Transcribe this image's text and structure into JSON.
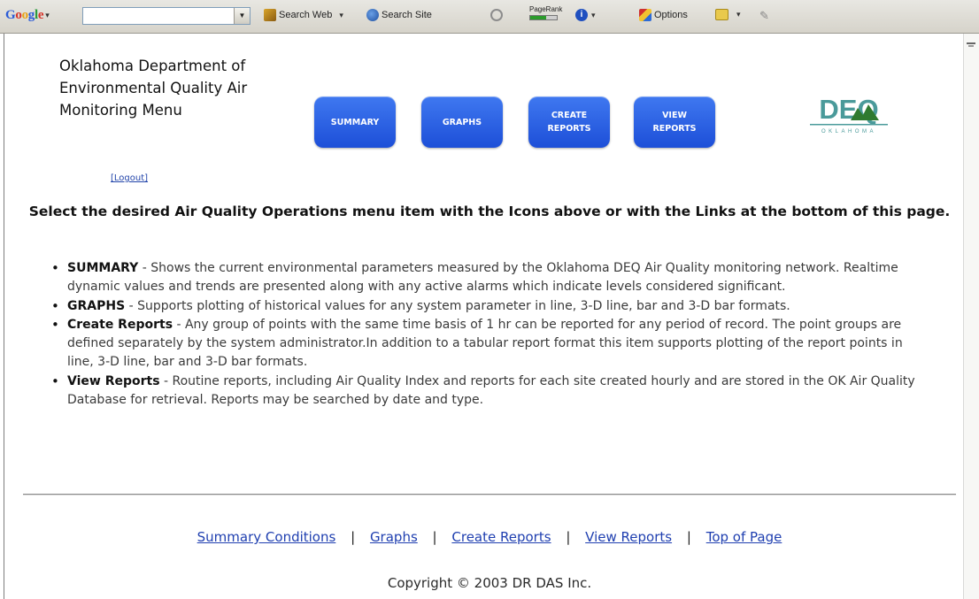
{
  "toolbar": {
    "logo_letters": [
      "G",
      "o",
      "o",
      "g",
      "l",
      "e"
    ],
    "search_value": "",
    "search_web": "Search Web",
    "search_site": "Search Site",
    "pagerank": "PageRank",
    "options": "Options"
  },
  "header": {
    "title": "Oklahoma Department of Environmental Quality Air Monitoring Menu",
    "logout": "[Logout]"
  },
  "nav": {
    "summary": "SUMMARY",
    "graphs": "GRAPHS",
    "create_reports": "CREATE REPORTS",
    "view_reports": "VIEW REPORTS"
  },
  "logo": {
    "text": "DEQ",
    "sub": "OKLAHOMA"
  },
  "instructions": "Select the desired Air Quality Operations menu item with the Icons above or with the Links at the bottom of this page.",
  "features": [
    {
      "term": "SUMMARY",
      "desc": " - Shows the current environmental parameters measured by the Oklahoma DEQ Air Quality monitoring network. Realtime dynamic values and trends are presented along with any active alarms which indicate levels considered significant."
    },
    {
      "term": "GRAPHS",
      "desc": " - Supports plotting of historical values for any system parameter in line, 3-D line, bar and 3-D bar formats."
    },
    {
      "term": "Create Reports",
      "desc": " - Any group of points with the same time basis of 1 hr can be reported for any period of record. The point groups are defined separately by the system administrator.In addition to a tabular report format this item supports plotting of the report points in line, 3-D line, bar and 3-D bar formats."
    },
    {
      "term": "View Reports",
      "desc": " - Routine reports, including Air Quality Index and reports for each site created hourly and are stored in the OK Air Quality Database for retrieval. Reports may be searched by date and type."
    }
  ],
  "footer": {
    "links": [
      "Summary Conditions",
      "Graphs",
      "Create Reports",
      "View Reports",
      "Top of Page"
    ],
    "separator": "|",
    "copyright": "Copyright © 2003 DR DAS Inc."
  },
  "colors": {
    "button_blue": "#2a5ee6",
    "link_blue": "#1f3fb0",
    "logo_teal": "#4a9a9a",
    "logo_green": "#2f7a2f"
  }
}
